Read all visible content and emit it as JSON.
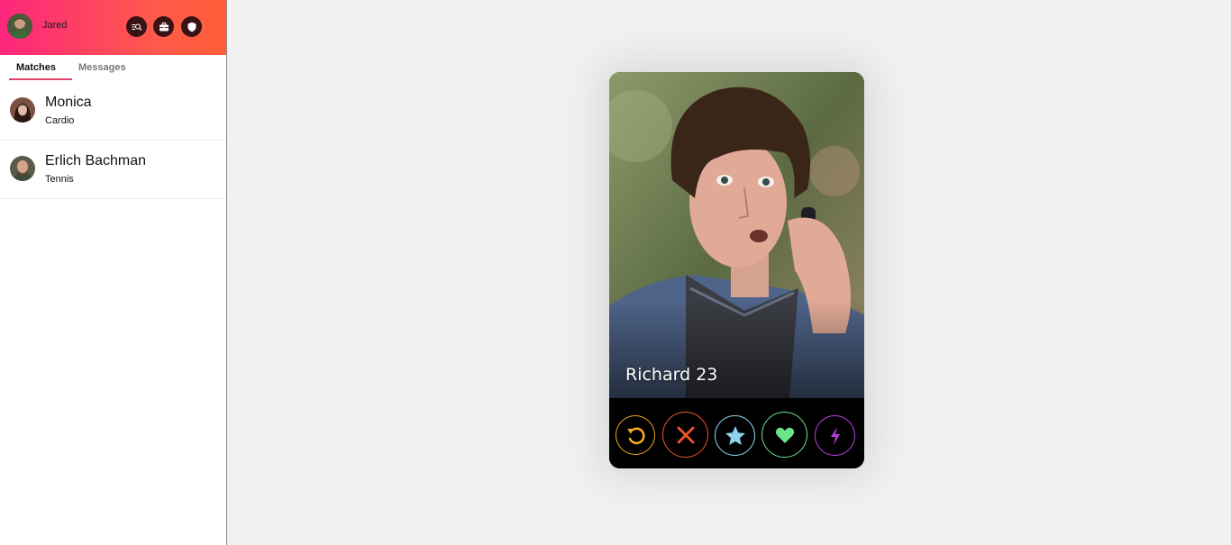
{
  "user": {
    "name": "Jared"
  },
  "header": {
    "icons": [
      "search-people-icon",
      "briefcase-icon",
      "shield-icon"
    ]
  },
  "tabs": {
    "matches": "Matches",
    "messages": "Messages"
  },
  "matches": [
    {
      "name": "Monica",
      "activity": "Cardio"
    },
    {
      "name": "Erlich Bachman",
      "activity": "Tennis"
    }
  ],
  "card": {
    "name_age": "Richard 23"
  },
  "actions": [
    {
      "icon": "rewind-icon",
      "color": "#f5a623"
    },
    {
      "icon": "nope-icon",
      "color": "#f2562f"
    },
    {
      "icon": "super-like-icon",
      "color": "#8fd2ee"
    },
    {
      "icon": "like-icon",
      "color": "#6de38a"
    },
    {
      "icon": "boost-icon",
      "color": "#b43ed8"
    }
  ],
  "colors": {
    "header_start": "#fd267d",
    "header_end": "#ff6036",
    "tab_accent": "#e0446a"
  }
}
